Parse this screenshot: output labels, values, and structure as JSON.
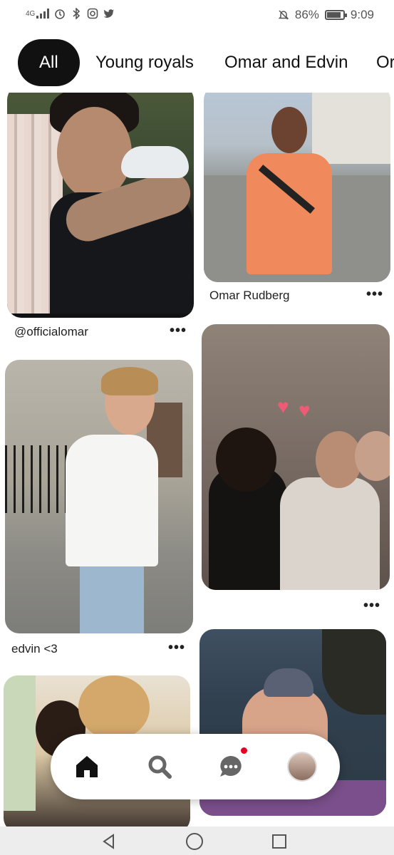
{
  "status_bar": {
    "network_label": "4G",
    "battery_percent": "86%",
    "battery_level": 0.86,
    "time": "9:09"
  },
  "tabs": [
    {
      "label": "All",
      "active": true
    },
    {
      "label": "Young royals",
      "active": false
    },
    {
      "label": "Omar and Edvin",
      "active": false
    },
    {
      "label": "Or",
      "active": false
    }
  ],
  "pins": [
    {
      "caption": "@officialomar",
      "more_label": "•••"
    },
    {
      "caption": "Omar Rudberg",
      "more_label": "•••"
    },
    {
      "caption": "edvin <3",
      "more_label": "•••"
    },
    {
      "caption": "",
      "more_label": "•••"
    }
  ],
  "bottom_nav": {
    "items": [
      "home-icon",
      "search-icon",
      "messages-icon",
      "profile-avatar"
    ],
    "messages_has_notification": true
  },
  "system_nav": [
    "back-icon",
    "home-circle-icon",
    "recents-icon"
  ],
  "colors": {
    "accent": "#e60023",
    "active_tab_bg": "#111111"
  }
}
